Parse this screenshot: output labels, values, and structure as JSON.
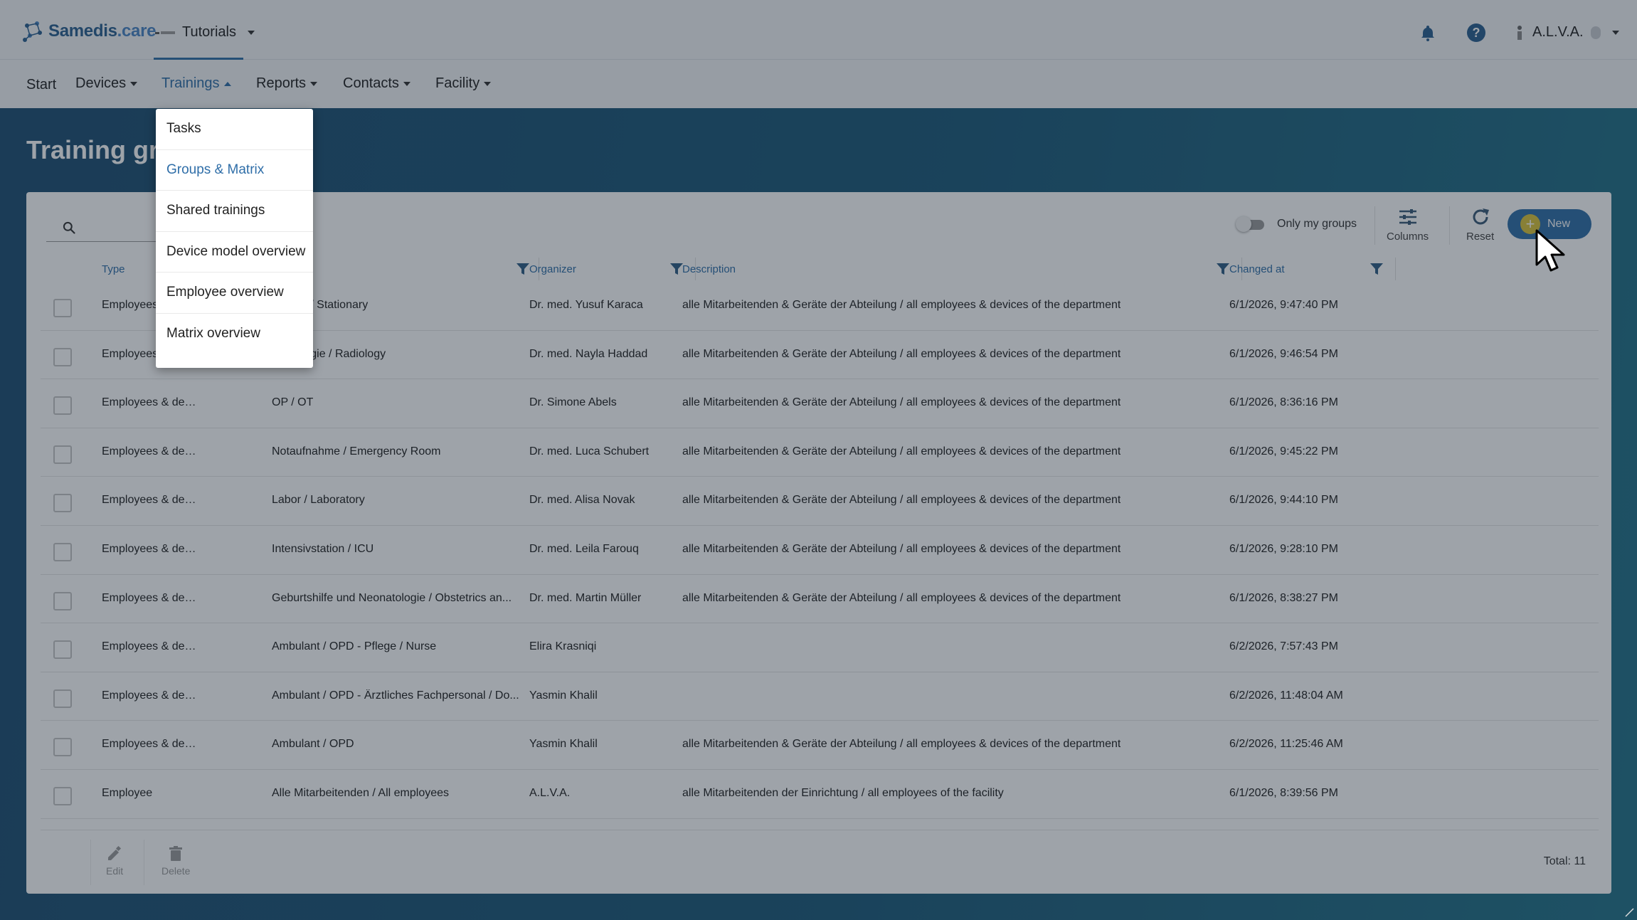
{
  "header": {
    "logo_text": "Samedis",
    "logo_suffix": ".care",
    "tenant_label": "Tutorials",
    "user_name": "A.L.V.A."
  },
  "nav": {
    "items": [
      {
        "label": "Start"
      },
      {
        "label": "Devices"
      },
      {
        "label": "Trainings"
      },
      {
        "label": "Reports"
      },
      {
        "label": "Contacts"
      },
      {
        "label": "Facility"
      }
    ],
    "active": "Trainings"
  },
  "page": {
    "title": "Training groups"
  },
  "dropdown": {
    "items": [
      {
        "label": "Tasks"
      },
      {
        "label": "Groups & Matrix"
      },
      {
        "label": "Shared trainings"
      },
      {
        "label": "Device model overview"
      },
      {
        "label": "Employee overview"
      },
      {
        "label": "Matrix overview"
      }
    ],
    "active": "Groups & Matrix"
  },
  "toolbar": {
    "toggle_label": "Only my groups",
    "columns_label": "Columns",
    "reset_label": "Reset",
    "new_label": "New"
  },
  "table": {
    "headers": {
      "type": "Type",
      "organizer": "Organizer",
      "description": "Description",
      "changed_at": "Changed at"
    },
    "rows": [
      {
        "type": "Employees & devices",
        "name": "Station / Stationary",
        "organizer": "Dr. med. Yusuf Karaca",
        "description": "alle Mitarbeitenden & Geräte der Abteilung / all employees & devices of the department",
        "changed": "6/1/2026, 9:47:40 PM"
      },
      {
        "type": "Employees & devices",
        "name": "Radiologie / Radiology",
        "organizer": "Dr. med. Nayla Haddad",
        "description": "alle Mitarbeitenden & Geräte der Abteilung / all employees & devices of the department",
        "changed": "6/1/2026, 9:46:54 PM"
      },
      {
        "type": "Employees & devices",
        "name": "OP / OT",
        "organizer": "Dr. Simone Abels",
        "description": "alle Mitarbeitenden & Geräte der Abteilung / all employees & devices of the department",
        "changed": "6/1/2026, 8:36:16 PM"
      },
      {
        "type": "Employees & devices",
        "name": "Notaufnahme / Emergency Room",
        "organizer": "Dr. med. Luca Schubert",
        "description": "alle Mitarbeitenden & Geräte der Abteilung / all employees & devices of the department",
        "changed": "6/1/2026, 9:45:22 PM"
      },
      {
        "type": "Employees & devices",
        "name": "Labor / Laboratory",
        "organizer": "Dr. med. Alisa Novak",
        "description": "alle Mitarbeitenden & Geräte der Abteilung / all employees & devices of the department",
        "changed": "6/1/2026, 9:44:10 PM"
      },
      {
        "type": "Employees & devices",
        "name": "Intensivstation / ICU",
        "organizer": "Dr. med. Leila Farouq",
        "description": "alle Mitarbeitenden & Geräte der Abteilung / all employees & devices of the department",
        "changed": "6/1/2026, 9:28:10 PM"
      },
      {
        "type": "Employees & devices",
        "name": "Geburtshilfe und Neonatologie / Obstetrics an...",
        "organizer": "Dr. med. Martin Müller",
        "description": "alle Mitarbeitenden & Geräte der Abteilung / all employees & devices of the department",
        "changed": "6/1/2026, 8:38:27 PM"
      },
      {
        "type": "Employees & devices",
        "name": "Ambulant / OPD - Pflege / Nurse",
        "organizer": "Elira Krasniqi",
        "description": "",
        "changed": "6/2/2026, 7:57:43 PM"
      },
      {
        "type": "Employees & devices",
        "name": "Ambulant / OPD - Ärztliches Fachpersonal / Do...",
        "organizer": "Yasmin Khalil",
        "description": "",
        "changed": "6/2/2026, 11:48:04 AM"
      },
      {
        "type": "Employees & devices",
        "name": "Ambulant / OPD",
        "organizer": "Yasmin Khalil",
        "description": "alle Mitarbeitenden & Geräte der Abteilung / all employees & devices of the department",
        "changed": "6/2/2026, 11:25:46 AM"
      },
      {
        "type": "Employee",
        "name": "Alle Mitarbeitenden / All employees",
        "organizer": "A.L.V.A.",
        "description": "alle Mitarbeitenden der Einrichtung / all employees of the facility",
        "changed": "6/1/2026, 8:39:56 PM"
      }
    ]
  },
  "footer": {
    "edit_label": "Edit",
    "delete_label": "Delete",
    "total_label": "Total: 11"
  },
  "colors": {
    "accent": "#2f6ea8",
    "new_plus": "#d9c33a"
  }
}
